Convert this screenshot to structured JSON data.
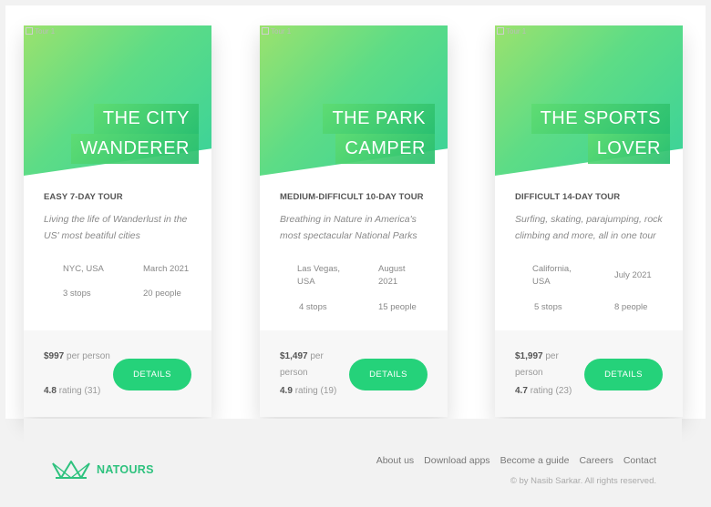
{
  "cards": [
    {
      "image_alt": "Tour 1",
      "title_line1": "THE CITY",
      "title_line2": "WANDERER",
      "difficulty": "EASY 7-DAY TOUR",
      "summary": "Living the life of Wanderlust in the US' most beatiful cities",
      "location": "NYC, USA",
      "date": "March 2021",
      "stops": "3 stops",
      "people": "20 people",
      "price": "$997",
      "price_unit": "per person",
      "rating": "4.8",
      "rating_word": "rating",
      "rating_count": "(31)",
      "button": "DETAILS"
    },
    {
      "image_alt": "Tour 1",
      "title_line1": "THE PARK",
      "title_line2": "CAMPER",
      "difficulty": "MEDIUM-DIFFICULT 10-DAY TOUR",
      "summary": "Breathing in Nature in America's most spectacular National Parks",
      "location": "Las Vegas, USA",
      "date": "August 2021",
      "stops": "4 stops",
      "people": "15 people",
      "price": "$1,497",
      "price_unit": "per person",
      "rating": "4.9",
      "rating_word": "rating",
      "rating_count": "(19)",
      "button": "DETAILS"
    },
    {
      "image_alt": "Tour 1",
      "title_line1": "THE SPORTS",
      "title_line2": "LOVER",
      "difficulty": "DIFFICULT 14-DAY TOUR",
      "summary": "Surfing, skating, parajumping, rock climbing and more, all in one tour",
      "location": "California, USA",
      "date": "July 2021",
      "stops": "5 stops",
      "people": "8 people",
      "price": "$1,997",
      "price_unit": "per person",
      "rating": "4.7",
      "rating_word": "rating",
      "rating_count": "(23)",
      "button": "DETAILS"
    }
  ],
  "footer": {
    "logo_text": "NATOURS",
    "nav": [
      "About us",
      "Download apps",
      "Become a guide",
      "Careers",
      "Contact"
    ],
    "copyright": "© by Nasib Sarkar. All rights reserved."
  },
  "colors": {
    "accent": "#25d27a",
    "gradient_light": "#9be26e",
    "gradient_dark": "#39d29a",
    "logo": "#2ec27e"
  }
}
